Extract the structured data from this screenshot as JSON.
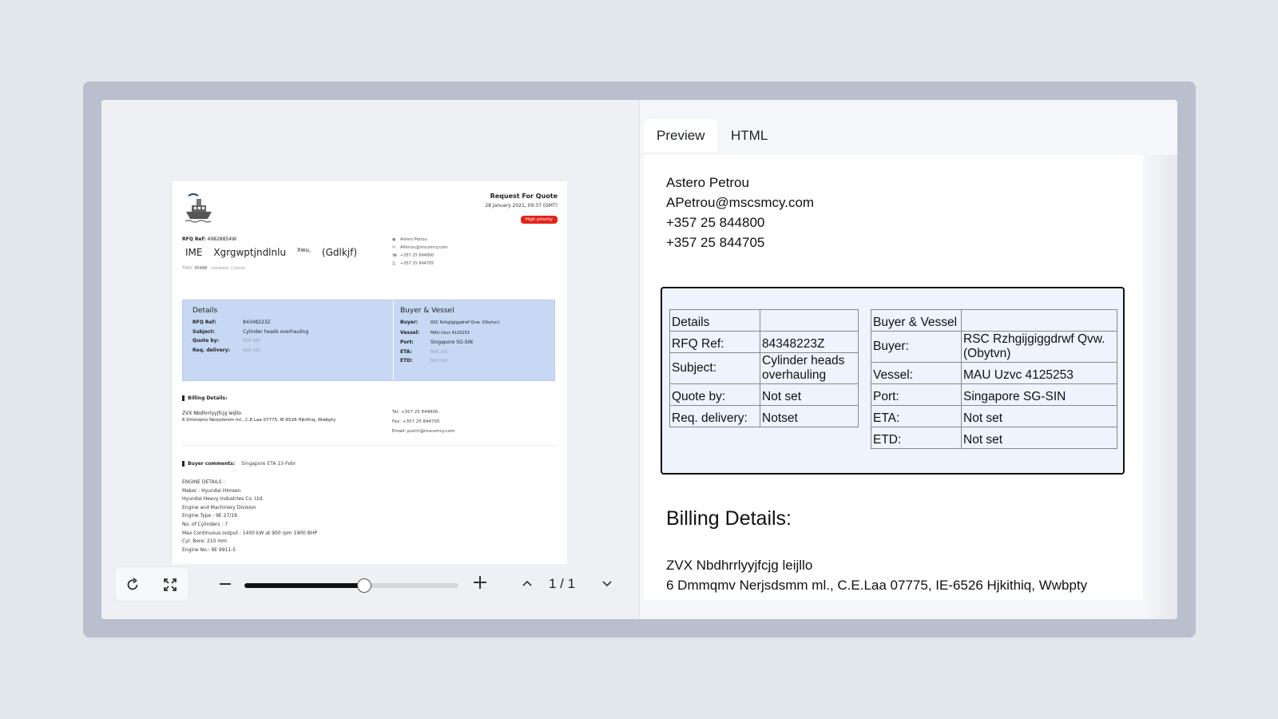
{
  "viewer": {
    "document": {
      "header_title": "Request For Quote",
      "header_date": "28 January 2021, 09:37 (GMT)",
      "priority_badge": "High priority",
      "rfq_ref_label": "RFQ Ref:",
      "rfq_ref_value": "49828854W",
      "company_parts": [
        "IME",
        "Xgrgwptjndlnlu",
        "Xwu,",
        "(Gdlkjf)"
      ],
      "tnid_label": "TNID:",
      "tnid_value": "95488",
      "tnid_location": "Limassol, Cyprus",
      "contact": [
        "Astero Petrou",
        "APetrou@mscsmcy.com",
        "+357 25 844800",
        "+357 25 844705"
      ],
      "details_title": "Details",
      "details_rows": [
        {
          "label": "RFQ Ref:",
          "value": "84348223Z"
        },
        {
          "label": "Subject:",
          "value": "Cylinder heads overhauling"
        },
        {
          "label": "Quote by:",
          "value": "Not set"
        },
        {
          "label": "Req. delivery:",
          "value": "Not set"
        }
      ],
      "buyer_title": "Buyer & Vessel",
      "buyer_rows": [
        {
          "label": "Buyer:",
          "value": "RSC Rzhgijgiggdrwf Qvw. (Obytvn)"
        },
        {
          "label": "Vessel:",
          "value": "MAU Uzvc 4125253"
        },
        {
          "label": "Port:",
          "value": "Singapore SG-SIN"
        },
        {
          "label": "ETA:",
          "value": "Not set"
        },
        {
          "label": "ETD:",
          "value": "Not set"
        }
      ],
      "billing_title": "Billing Details:",
      "billing_line1": "ZVX  Nbdhrrlyyjfcjg  leijllo",
      "billing_line2": "6 Dmmqmv Nerjsdsmm ml., C.E.Laa 07775, IE-6526 Hjkithiq, Wwbpty",
      "billing_tel": "Tel: +357 25 844800",
      "billing_fax": "Fax: +357 25 844705",
      "billing_email": "Email: purch@mscsmcy.com",
      "comments_title": "Buyer comments:",
      "comments_value": "Singapore ETA 13-Febr",
      "engine_lines": [
        "ENGINE DETAILS :",
        "Maker : Hyundai Himsen",
        "Hyundai Heavy Industries Co. Ltd.",
        "Engine and Machinery Division",
        "Engine Type : 9E 27/19",
        "No. of Cylinders : 7",
        "Max Continuous output : 1400 kW at 900 rpm 1900 BHP",
        "Cyl. Bore: 210 mm",
        "Engine No.: 9E 9911-5"
      ]
    },
    "zoom_fraction": 0.56,
    "page_indicator": "1 / 1"
  },
  "tabs": [
    {
      "label": "Preview",
      "active": true
    },
    {
      "label": "HTML",
      "active": false
    }
  ],
  "preview": {
    "contact_lines": [
      "Astero Petrou",
      "APetrou@mscsmcy.com",
      "+357 25 844800",
      "+357 25 844705"
    ],
    "details_table": [
      [
        "Details",
        ""
      ],
      [
        "RFQ Ref:",
        "84348223Z"
      ],
      [
        "Subject:",
        "Cylinder heads overhauling"
      ],
      [
        "Quote by:",
        "Not set"
      ],
      [
        "Req. delivery:",
        "Notset"
      ]
    ],
    "buyer_table": [
      [
        "Buyer & Vessel",
        ""
      ],
      [
        "Buyer:",
        "RSC Rzhgijgiggdrwf Qvw. (Obytvn)"
      ],
      [
        "Vessel:",
        "MAU Uzvc 4125253"
      ],
      [
        "Port:",
        "Singapore SG-SIN"
      ],
      [
        "ETA:",
        "Not set"
      ],
      [
        "ETD:",
        "Not set"
      ]
    ],
    "billing_title": "Billing Details:",
    "billing_lines": [
      "ZVX Nbdhrrlyyjfcjg leijllo",
      "6 Dmmqmv Nerjsdsmm ml., C.E.Laa 07775, IE-6526 Hjkithiq, Wwbpty"
    ]
  },
  "icons": {
    "refresh": "refresh-icon",
    "fullscreen": "fullscreen-icon",
    "zoom_out": "minus-icon",
    "zoom_in": "plus-icon",
    "prev_page": "chevron-up-icon",
    "next_page": "chevron-down-icon",
    "logo": "ship-icon"
  },
  "colors": {
    "details_fill": "#c6d8f4",
    "priority": "#e2231a",
    "preview_table_fill": "#eef3fd"
  }
}
